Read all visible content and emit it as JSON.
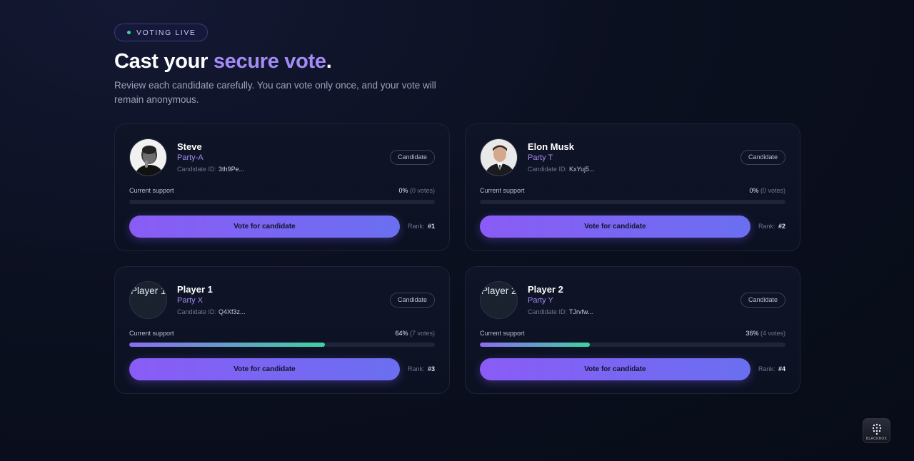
{
  "header": {
    "badge": "VOTING LIVE",
    "title_main": "Cast your ",
    "title_accent": "secure vote",
    "title_end": ".",
    "subtitle": "Review each candidate carefully. You can vote only once, and your vote will remain anonymous."
  },
  "candidates": [
    {
      "name": "Steve",
      "party": "Party-A",
      "id_label": "Candidate ID:",
      "id_value": "3th9Pe...",
      "tag": "Candidate",
      "support_label": "Current support",
      "percent": "0%",
      "votes": "(0 votes)",
      "support_fraction": 0,
      "vote_label": "Vote for candidate",
      "rank_label": "Rank:",
      "rank_value": "#1",
      "avatar": "photo"
    },
    {
      "name": "Elon Musk",
      "party": "Party T",
      "id_label": "Candidate ID:",
      "id_value": "KxYuj5...",
      "tag": "Candidate",
      "support_label": "Current support",
      "percent": "0%",
      "votes": "(0 votes)",
      "support_fraction": 0,
      "vote_label": "Vote for candidate",
      "rank_label": "Rank:",
      "rank_value": "#2",
      "avatar": "photo"
    },
    {
      "name": "Player 1",
      "party": "Party X",
      "id_label": "Candidate ID:",
      "id_value": "Q4Xf3z...",
      "tag": "Candidate",
      "support_label": "Current support",
      "percent": "64%",
      "votes": "(7 votes)",
      "support_fraction": 0.64,
      "vote_label": "Vote for candidate",
      "rank_label": "Rank:",
      "rank_value": "#3",
      "avatar": "broken",
      "avatar_alt": "Player 1"
    },
    {
      "name": "Player 2",
      "party": "Party Y",
      "id_label": "Candidate ID:",
      "id_value": "TJrvfw...",
      "tag": "Candidate",
      "support_label": "Current support",
      "percent": "36%",
      "votes": "(4 votes)",
      "support_fraction": 0.36,
      "vote_label": "Vote for candidate",
      "rank_label": "Rank:",
      "rank_value": "#4",
      "avatar": "broken",
      "avatar_alt": "Player 2"
    }
  ],
  "brand": {
    "label": "BLACKBOX",
    "icon": "blackbox-logo-icon"
  },
  "colors": {
    "accent": "#a48cf7",
    "live_dot": "#3dd598",
    "button_start": "#8a5cf6",
    "button_end": "#6a6ff0"
  }
}
